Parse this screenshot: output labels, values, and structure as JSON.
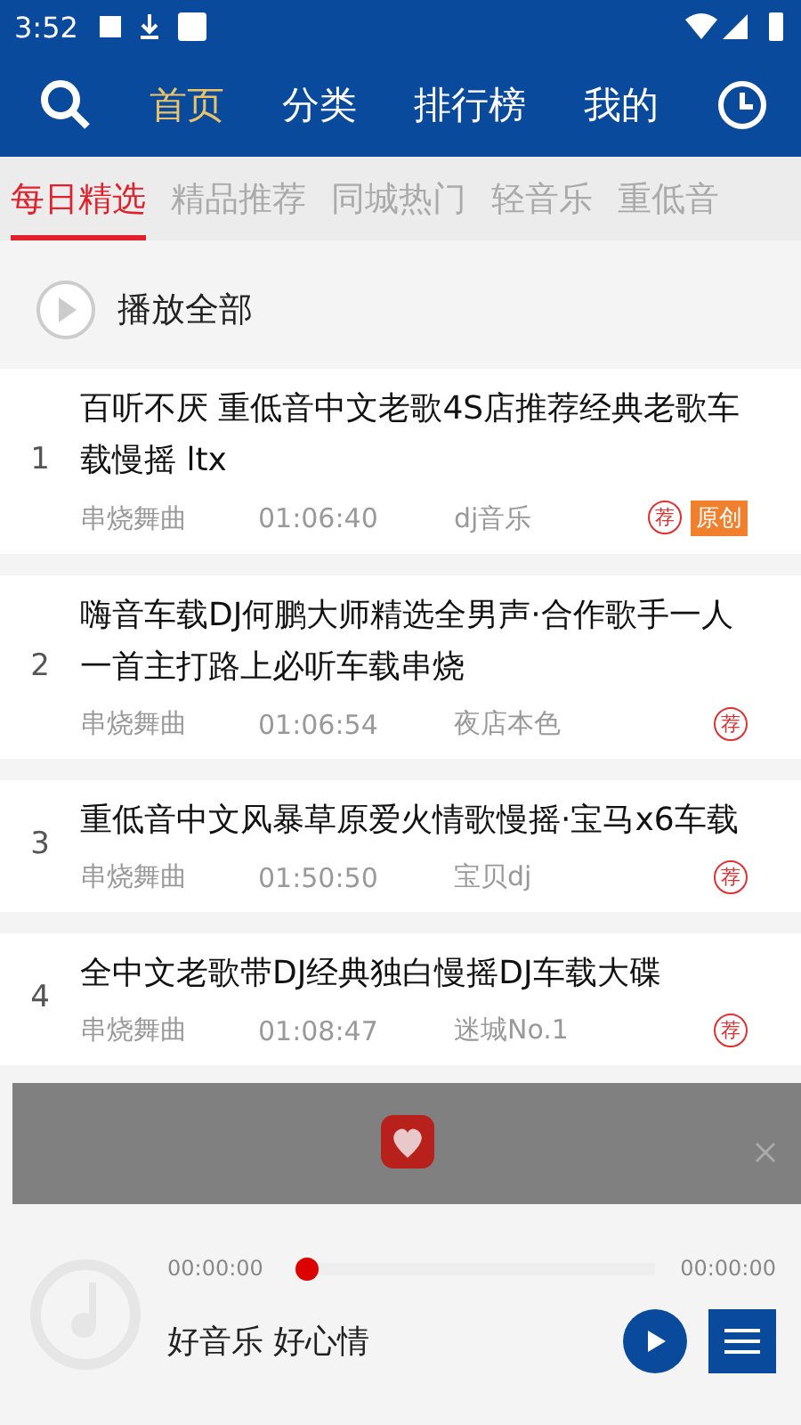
{
  "status_bar": {
    "time": "3:52"
  },
  "nav": {
    "items": [
      {
        "label": "首页",
        "selected": true
      },
      {
        "label": "分类",
        "selected": false
      },
      {
        "label": "排行榜",
        "selected": false
      },
      {
        "label": "我的",
        "selected": false
      }
    ]
  },
  "tabs": [
    {
      "label": "每日精选",
      "selected": true
    },
    {
      "label": "精品推荐",
      "selected": false
    },
    {
      "label": "同城热门",
      "selected": false
    },
    {
      "label": "轻音乐",
      "selected": false
    },
    {
      "label": "重低音",
      "selected": false
    }
  ],
  "play_all": {
    "label": "播放全部"
  },
  "songs": [
    {
      "index": "1",
      "title": "百听不厌 重低音中文老歌4S店推荐经典老歌车载慢摇 ltx",
      "genre": "串烧舞曲",
      "duration": "01:06:40",
      "artist": "dj音乐",
      "badges": [
        {
          "kind": "stamp",
          "label": "荐"
        },
        {
          "kind": "tag",
          "label": "原创"
        }
      ]
    },
    {
      "index": "2",
      "title": "嗨音车载DJ何鹏大师精选全男声·合作歌手一人一首主打路上必听车载串烧",
      "genre": "串烧舞曲",
      "duration": "01:06:54",
      "artist": "夜店本色",
      "badges": [
        {
          "kind": "stamp",
          "label": "荐"
        }
      ]
    },
    {
      "index": "3",
      "title": "重低音中文风暴草原爱火情歌慢摇·宝马x6车载",
      "genre": "串烧舞曲",
      "duration": "01:50:50",
      "artist": "宝贝dj",
      "badges": [
        {
          "kind": "stamp",
          "label": "荐"
        }
      ]
    },
    {
      "index": "4",
      "title": "全中文老歌带DJ经典独白慢摇DJ车载大碟",
      "genre": "串烧舞曲",
      "duration": "01:08:47",
      "artist": "迷城No.1",
      "badges": [
        {
          "kind": "stamp",
          "label": "荐"
        }
      ]
    }
  ],
  "player": {
    "elapsed": "00:00:00",
    "total": "00:00:00",
    "level": 0,
    "caption": "好音乐 好心情"
  }
}
